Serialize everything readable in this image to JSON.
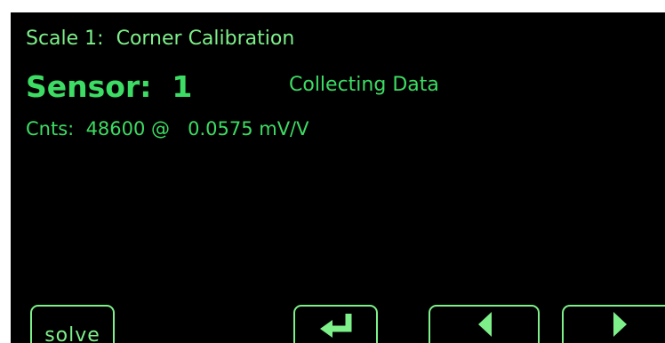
{
  "header": {
    "title": "Scale 1:  Corner Calibration"
  },
  "sensor": {
    "label": "Sensor:  1",
    "status": "Collecting Data"
  },
  "readout": {
    "counts_line": "Cnts:  48600 @   0.0575 mV/V"
  },
  "softkeys": {
    "solve_label": "solve",
    "enter_icon": "enter-return-icon",
    "left_icon": "arrow-left-icon",
    "right_icon": "arrow-right-icon"
  },
  "colors": {
    "background": "#000000",
    "text_primary": "#7ef08a",
    "text_accent": "#3ddc64",
    "border": "#ffffff"
  }
}
